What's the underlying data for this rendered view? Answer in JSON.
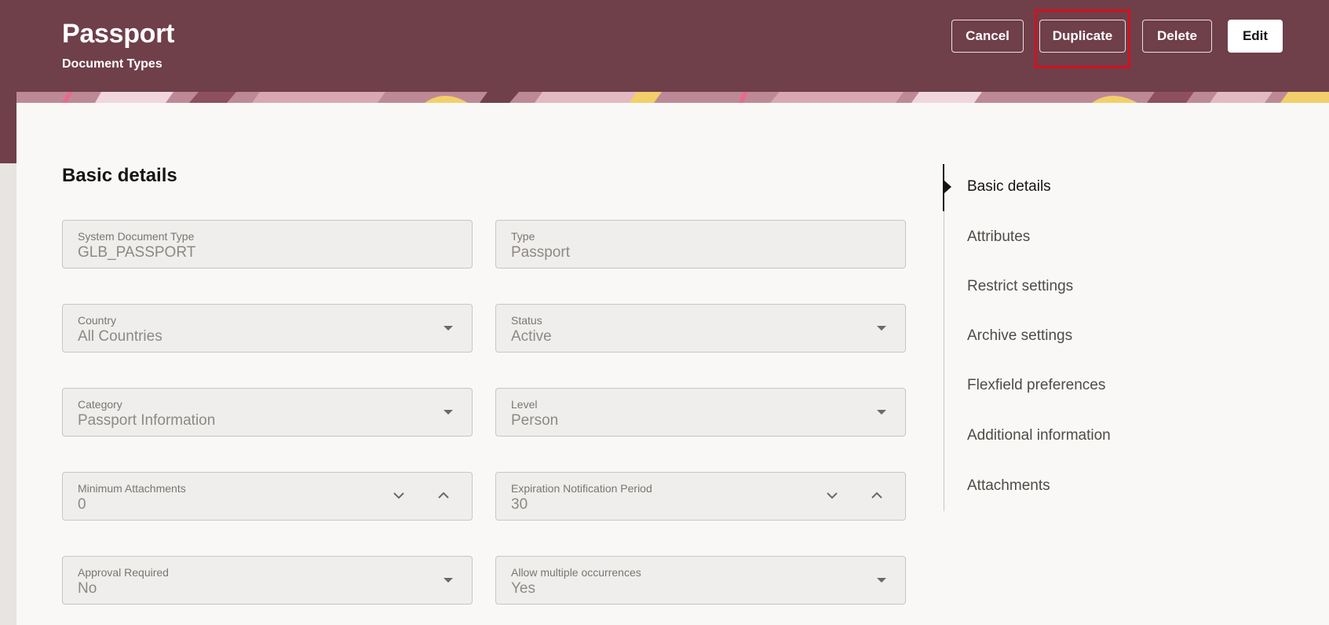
{
  "header": {
    "title": "Passport",
    "subtitle": "Document Types",
    "buttons": {
      "cancel": "Cancel",
      "duplicate": "Duplicate",
      "delete": "Delete",
      "edit": "Edit"
    }
  },
  "colors": {
    "header_bg": "#6f3f4a",
    "highlight": "#d1121c",
    "banner_pink": "#e86a8c",
    "banner_yellow": "#f2cf6a"
  },
  "section": {
    "title": "Basic details"
  },
  "fields": {
    "system_document_type": {
      "label": "System Document Type",
      "value": "GLB_PASSPORT"
    },
    "type": {
      "label": "Type",
      "value": "Passport"
    },
    "country": {
      "label": "Country",
      "value": "All Countries"
    },
    "status": {
      "label": "Status",
      "value": "Active"
    },
    "category": {
      "label": "Category",
      "value": "Passport Information"
    },
    "level": {
      "label": "Level",
      "value": "Person"
    },
    "minimum_attachments": {
      "label": "Minimum Attachments",
      "value": "0"
    },
    "expiration_notification_period": {
      "label": "Expiration Notification Period",
      "value": "30"
    },
    "approval_required": {
      "label": "Approval Required",
      "value": "No"
    },
    "allow_multiple_occurrences": {
      "label": "Allow multiple occurrences",
      "value": "Yes"
    }
  },
  "nav": {
    "items": [
      {
        "label": "Basic details",
        "active": true
      },
      {
        "label": "Attributes"
      },
      {
        "label": "Restrict settings"
      },
      {
        "label": "Archive settings"
      },
      {
        "label": "Flexfield preferences"
      },
      {
        "label": "Additional information"
      },
      {
        "label": "Attachments"
      }
    ]
  },
  "icons": {
    "dropdown": "caret-down-icon",
    "decrement": "chevron-down-icon",
    "increment": "chevron-up-icon",
    "nav_indicator": "triangle-right-icon"
  }
}
